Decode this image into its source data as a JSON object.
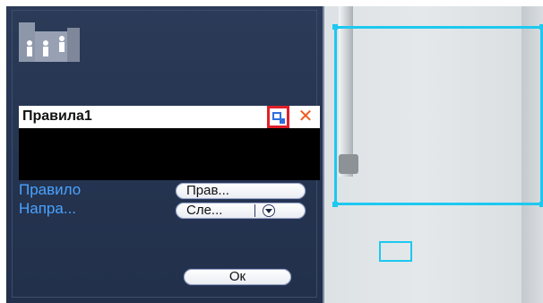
{
  "header": {
    "icon": "people-icon"
  },
  "rules": {
    "items": [
      {
        "name": "Правила1",
        "edit_icon": "edit-icon",
        "delete_icon": "delete-icon"
      }
    ]
  },
  "fields": {
    "rule": {
      "label": "Правило",
      "value": "Прав..."
    },
    "direction": {
      "label": "Напра...",
      "value": "Сле...",
      "dropdown_icon": "chevron-down-icon"
    }
  },
  "actions": {
    "ok_label": "Ок"
  },
  "colors": {
    "panel": "#24334f",
    "label": "#4aa3ff",
    "highlight": "#e0202a",
    "delete": "#f05a1a",
    "zone": "#1ec8f0"
  }
}
